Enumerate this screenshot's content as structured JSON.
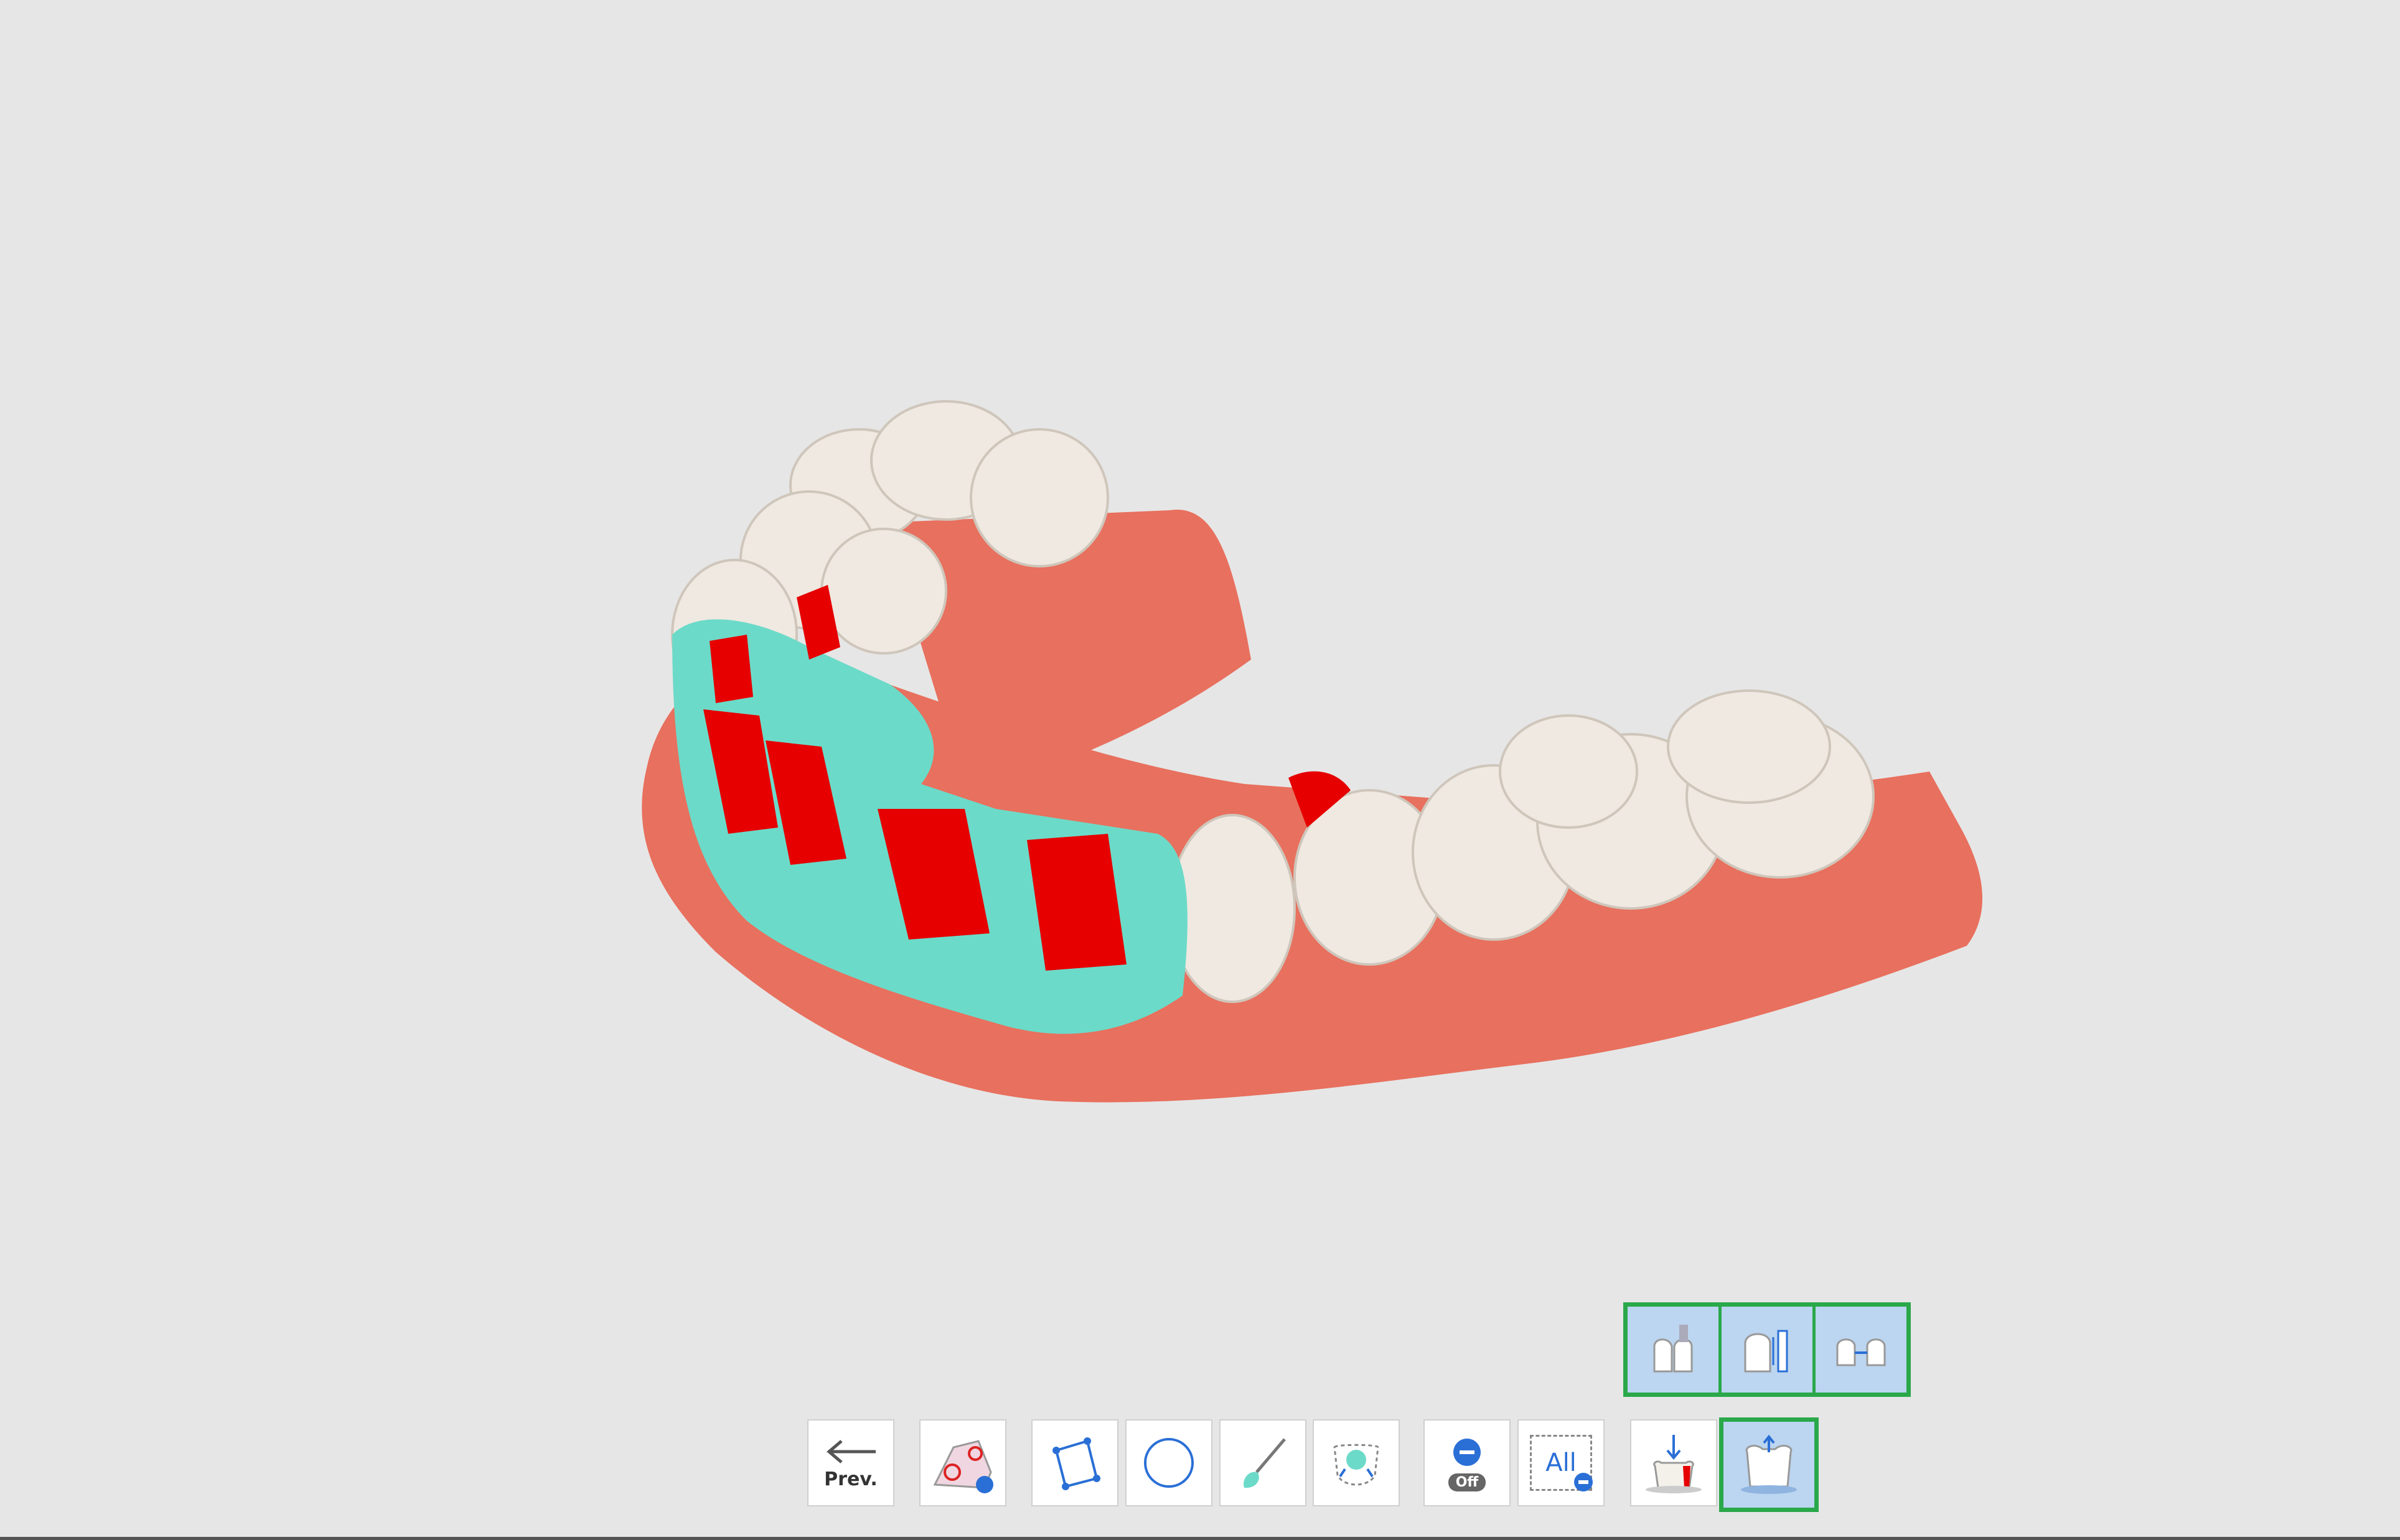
{
  "toolbar": {
    "prev_label": "Prev.",
    "erase_toggle_off_label": "Off",
    "select_all_label": "All",
    "buttons": [
      {
        "name": "prev-button",
        "icon": "arrow-left-icon"
      },
      {
        "name": "margin-settings-button",
        "icon": "margin-settings-icon"
      },
      {
        "name": "polygon-select-button",
        "icon": "polygon-icon"
      },
      {
        "name": "circle-select-button",
        "icon": "circle-icon"
      },
      {
        "name": "brush-select-button",
        "icon": "brush-icon"
      },
      {
        "name": "smart-select-button",
        "icon": "smart-selection-icon"
      },
      {
        "name": "erase-toggle-button",
        "icon": "minus-toggle-off-icon"
      },
      {
        "name": "deselect-all-button",
        "icon": "all-minus-icon"
      },
      {
        "name": "fill-undercut-button",
        "icon": "fill-undercut-icon"
      },
      {
        "name": "offset-button",
        "icon": "offset-icon",
        "active": true
      }
    ]
  },
  "sub_toolbar": {
    "buttons": [
      {
        "name": "sub-tool-1",
        "icon": "tooth-drill-icon"
      },
      {
        "name": "sub-tool-2",
        "icon": "tooth-ruler-icon"
      },
      {
        "name": "sub-tool-3",
        "icon": "tooth-horizontal-icon"
      }
    ]
  },
  "colors": {
    "background": "#e6e6e6",
    "gum": "#e8705e",
    "tooth": "#efe9e1",
    "selection": "#6cdac8",
    "undercut": "#e60000",
    "active_border": "#2aa84a",
    "active_fill": "#bcd5f0"
  }
}
